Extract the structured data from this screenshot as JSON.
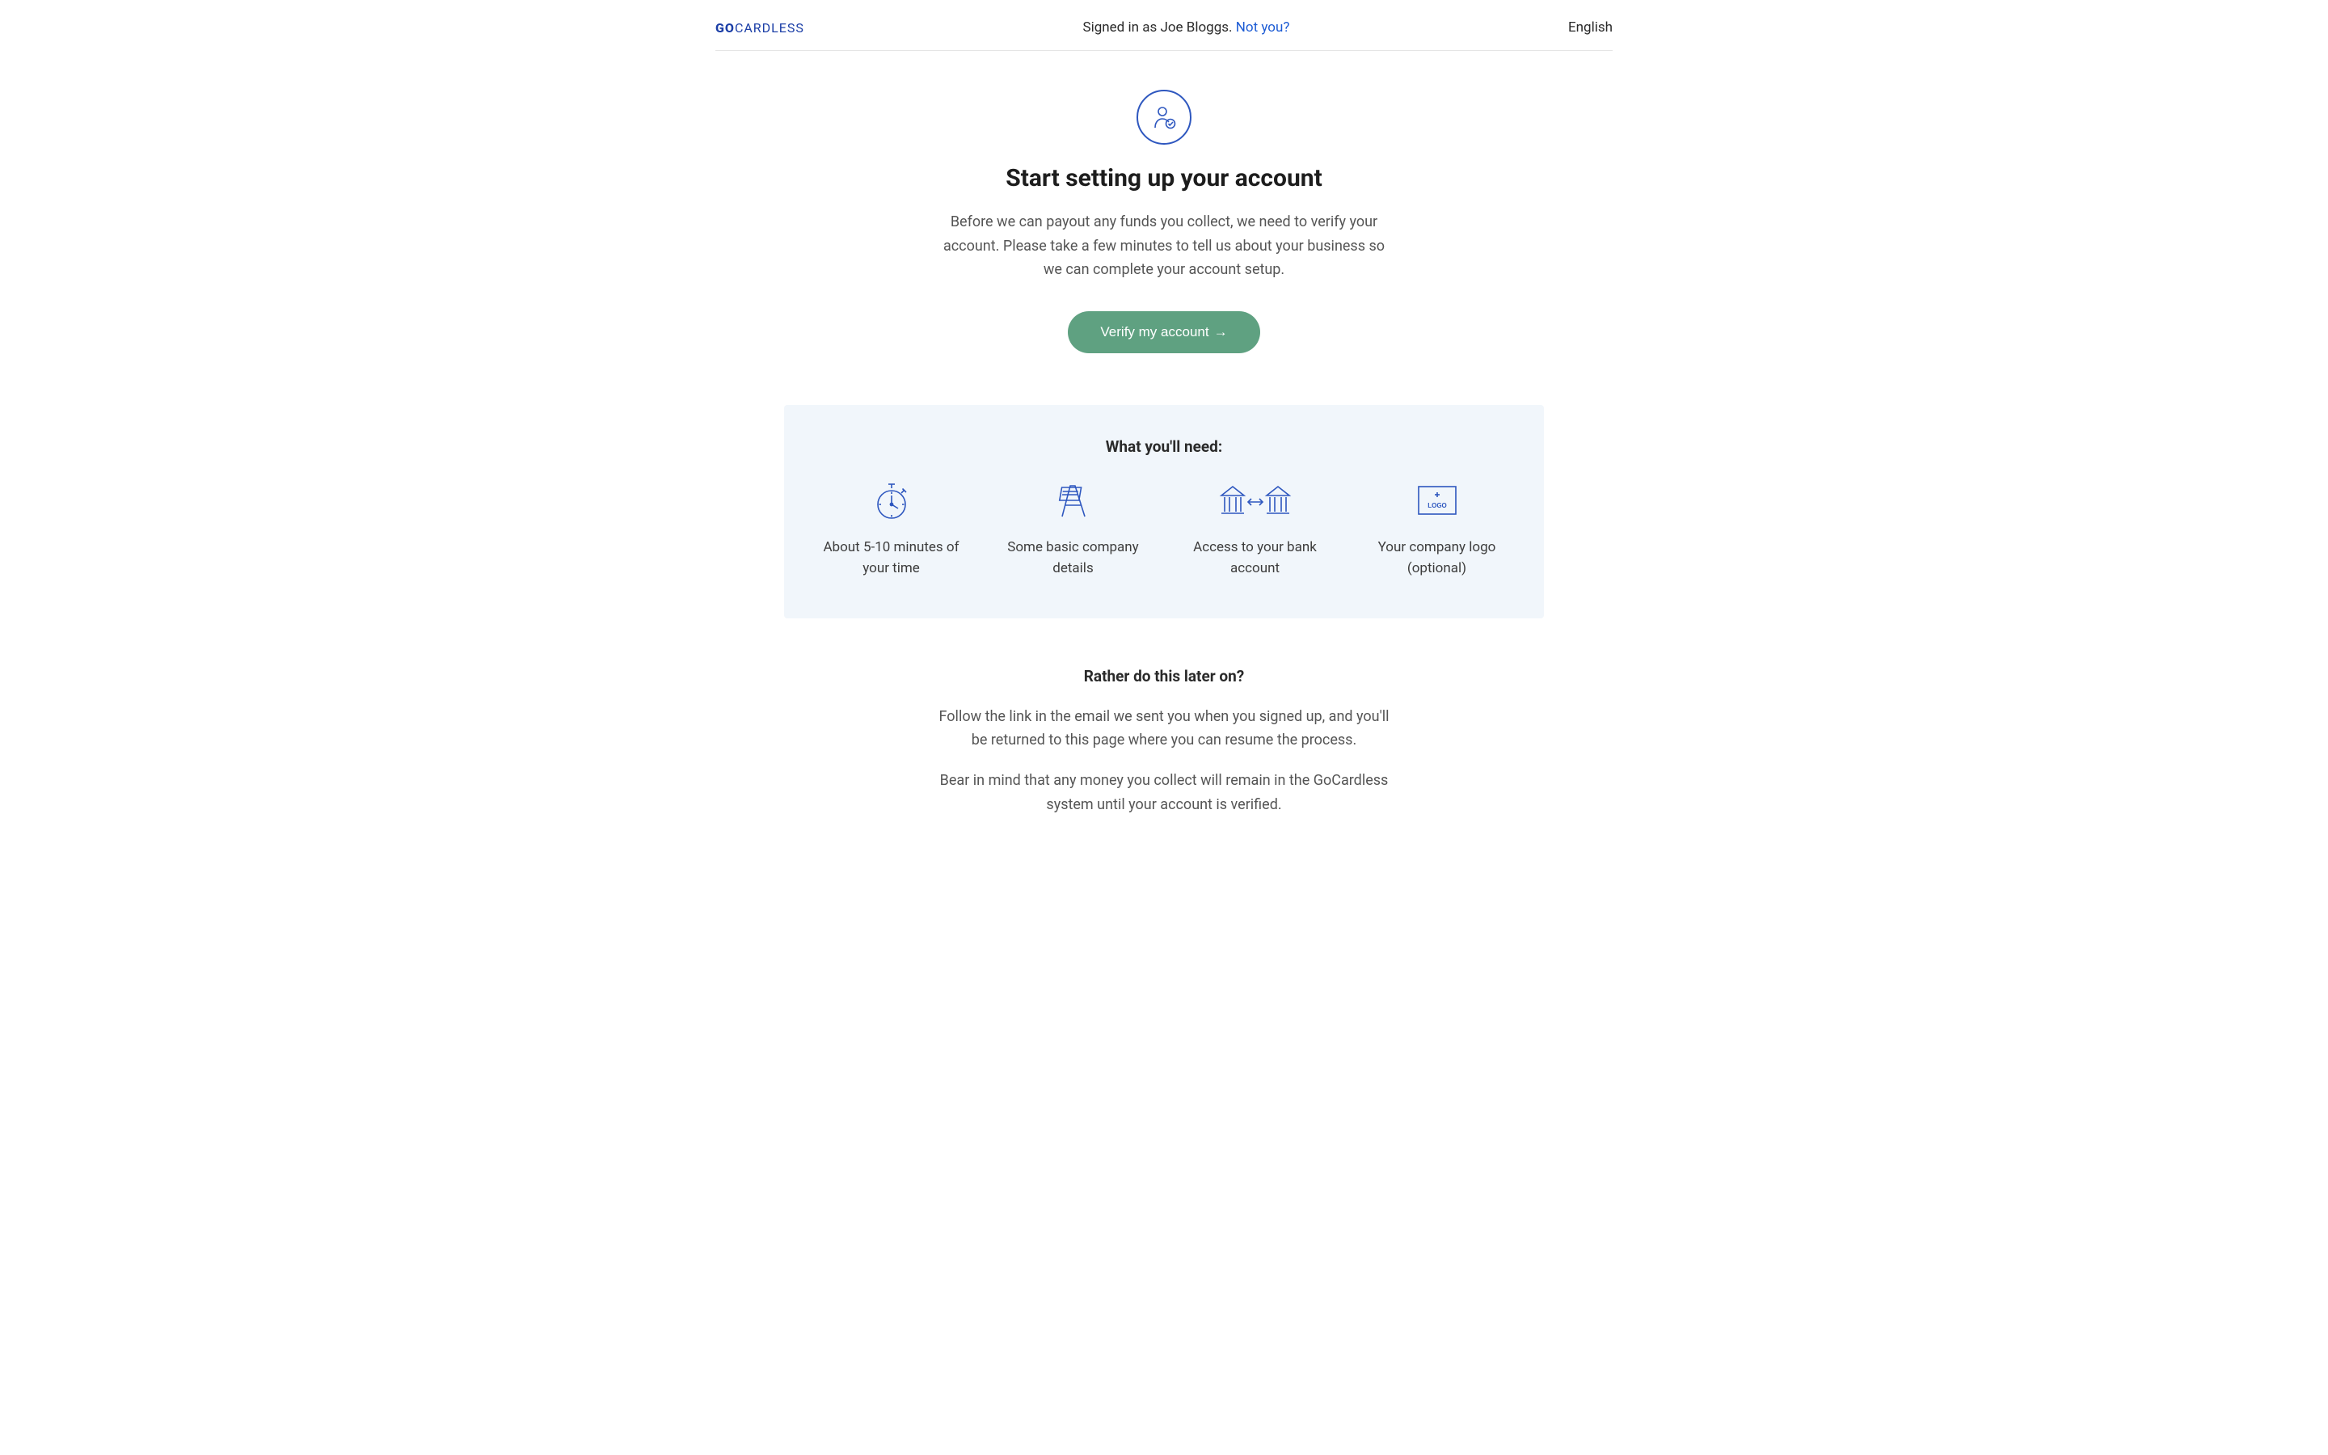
{
  "brand": {
    "go": "GO",
    "cardless": "CARDLESS"
  },
  "header": {
    "signed_in_prefix": "Signed in as ",
    "user_name": "Joe Bloggs",
    "signed_in_suffix": ". ",
    "not_you": "Not you?",
    "language": "English"
  },
  "hero": {
    "title": "Start setting up your account",
    "description": "Before we can payout any funds you collect, we need to verify your account. Please take a few minutes to tell us about your business so we can complete your account setup.",
    "cta_label": "Verify my account"
  },
  "need": {
    "heading": "What you'll need:",
    "items": [
      {
        "text": "About 5-10 minutes of your time"
      },
      {
        "text": "Some basic company details"
      },
      {
        "text": "Access to your bank account"
      },
      {
        "text": "Your company logo (optional)"
      }
    ]
  },
  "later": {
    "heading": "Rather do this later on?",
    "p1": "Follow the link in the email we sent you when you signed up, and you'll be returned to this page where you can resume the process.",
    "p2": "Bear in mind that any money you collect will remain in the GoCardless system until your account is verified."
  }
}
